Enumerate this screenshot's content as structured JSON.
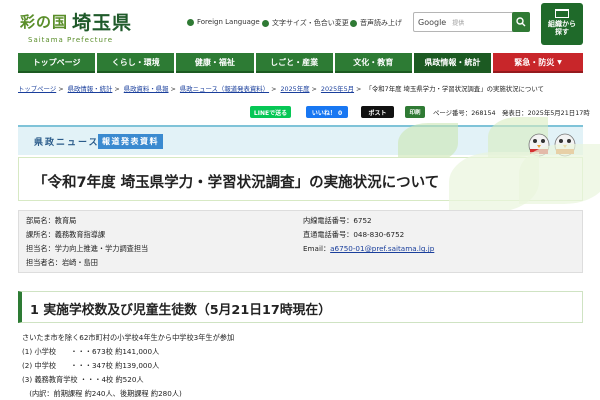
{
  "header": {
    "logo_left": "彩の国",
    "logo_right": "埼玉県",
    "logo_sub": "Saitama Prefecture",
    "util_links": [
      "Foreign Language",
      "文字サイズ・色合い変更",
      "音声読み上げ"
    ],
    "search_brand": "Google",
    "search_placeholder": "提供",
    "org_button": [
      "組織から",
      "探す"
    ]
  },
  "nav": {
    "items": [
      "トップページ",
      "くらし・環境",
      "健康・福祉",
      "しごと・産業",
      "文化・教育",
      "県政情報・統計"
    ],
    "active_index": 5,
    "emergency": "緊急・防災"
  },
  "breadcrumb": {
    "items": [
      "トップページ",
      "県政情報・統計",
      "県政資料・県報",
      "県政ニュース（報道発表資料）",
      "2025年度",
      "2025年5月"
    ],
    "current": "「令和7年度 埼玉県学力・学習状況調査」の実施状況について"
  },
  "share": {
    "line": "LINEで送る",
    "facebook": "いいね！ 0",
    "x": "ポスト",
    "print": "印刷",
    "page_info": "ページ番号：268154　発表日：2025年5月21日17時"
  },
  "banner": {
    "label": "県政ニュース",
    "tag": "報道発表資料"
  },
  "page_title": "「令和7年度 埼玉県学力・学習状況調査」の実施状況について",
  "contact": {
    "dept": "部局名：教育局",
    "section": "課所名：義務教育指導課",
    "staff": "担当名：学力向上推進・学力調査担当",
    "person": "担当者名：岩崎・島田",
    "ext": "内線電話番号：6752",
    "direct": "直通電話番号：048-830-6752",
    "email_label": "Email：",
    "email": "a6750-01@pref.saitama.lg.jp"
  },
  "section1": {
    "heading": "1 実施学校数及び児童生徒数（5月21日17時現在）",
    "lines": [
      "さいたま市を除く62市町村の小学校4年生から中学校3年生が参加",
      "(1) 小学校　　・・・673校  約141,000人",
      "(2) 中学校　　・・・347校  約139,000人",
      "(3) 義務教育学校 ・・・4校  約520人",
      "　(内訳：前期課程 約240人、後期課程 約280人)"
    ]
  },
  "colors": {
    "primary_green": "#2d7b34",
    "dark_green": "#1c5a22",
    "emergency_red": "#c8262a",
    "link_blue": "#1a3f9c"
  }
}
